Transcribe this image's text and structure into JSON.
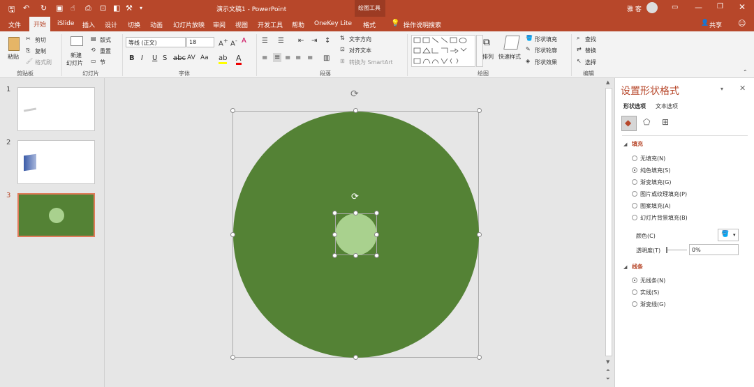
{
  "window": {
    "title": "演示文稿1 - PowerPoint",
    "context_title": "绘图工具",
    "user": "雅 客",
    "share": "共享"
  },
  "tabs": [
    "文件",
    "开始",
    "iSlide",
    "插入",
    "设计",
    "切换",
    "动画",
    "幻灯片放映",
    "审阅",
    "视图",
    "开发工具",
    "帮助",
    "OneKey Lite",
    "格式"
  ],
  "tell_me": "操作说明搜索",
  "ribbon": {
    "clipboard": {
      "paste": "粘贴",
      "cut": "剪切",
      "copy": "复制",
      "format_painter": "格式刷",
      "label": "剪贴板"
    },
    "slides": {
      "new_slide": "新建",
      "new_slide2": "幻灯片",
      "layout": "版式",
      "reset": "重置",
      "section": "节",
      "label": "幻灯片"
    },
    "font": {
      "name": "等线 (正文)",
      "size": "18",
      "label": "字体"
    },
    "paragraph": {
      "text_direction": "文字方向",
      "align_text": "对齐文本",
      "smartart": "转换为 SmartArt",
      "label": "段落"
    },
    "drawing": {
      "arrange": "排列",
      "quick_styles": "快速样式",
      "fill": "形状填充",
      "outline": "形状轮廓",
      "effects": "形状效果",
      "label": "绘图"
    },
    "editing": {
      "find": "查找",
      "replace": "替换",
      "select": "选择",
      "label": "编辑"
    }
  },
  "slides": [
    {
      "num": "1"
    },
    {
      "num": "2"
    },
    {
      "num": "3"
    }
  ],
  "format_pane": {
    "title": "设置形状格式",
    "tab_shape": "形状选项",
    "tab_text": "文本选项",
    "fill_section": "填充",
    "fill_options": [
      {
        "label": "无填充(N)",
        "selected": false
      },
      {
        "label": "纯色填充(S)",
        "selected": true
      },
      {
        "label": "渐变填充(G)",
        "selected": false
      },
      {
        "label": "图片或纹理填充(P)",
        "selected": false
      },
      {
        "label": "图案填充(A)",
        "selected": false
      },
      {
        "label": "幻灯片背景填充(B)",
        "selected": false
      }
    ],
    "color_label": "颜色(C)",
    "transparency_label": "透明度(T)",
    "transparency_value": "0%",
    "line_section": "线条",
    "line_options": [
      {
        "label": "无线条(N)",
        "selected": true
      },
      {
        "label": "实线(S)",
        "selected": false
      },
      {
        "label": "渐变线(G)",
        "selected": false
      }
    ]
  },
  "colors": {
    "accent": "#b7472a",
    "big_circle": "#548235",
    "small_circle": "#a9d18e"
  }
}
